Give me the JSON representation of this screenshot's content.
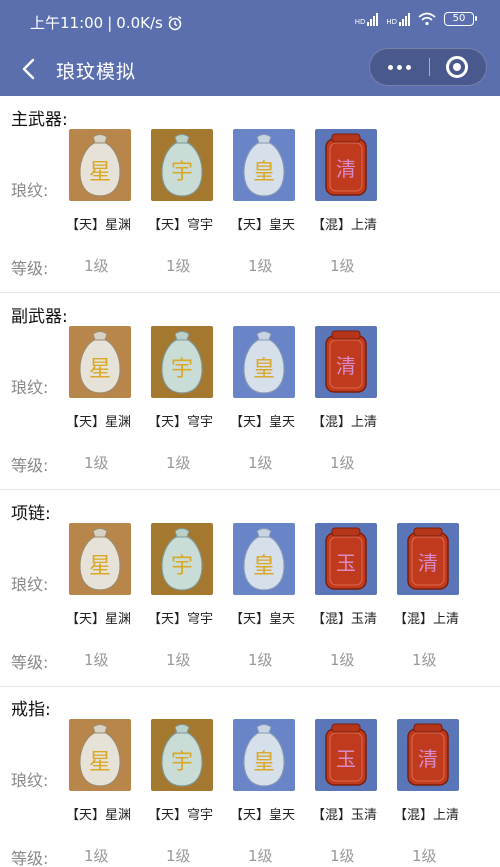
{
  "status": {
    "time": "上午11:00",
    "speed": "0.0K/s",
    "battery": "50",
    "hd1": "HD",
    "hd2": "HD"
  },
  "nav": {
    "title": "琅玟模拟"
  },
  "labels": {
    "pattern": "琅纹:",
    "level": "等级:"
  },
  "colors": {
    "header": "#5b6faf",
    "bronze_bg": "#b8864a",
    "teal_bg": "#a5782f",
    "blue_bg": "#6a85c7",
    "chaos_bg": "#5a76b8",
    "chaos_gem": "#c03a1e"
  },
  "sections": [
    {
      "title": "主武器:",
      "items": [
        {
          "name": "【天】星渊",
          "level": "1级",
          "type": "star",
          "glyph": "星"
        },
        {
          "name": "【天】穹宇",
          "level": "1级",
          "type": "sky",
          "glyph": "宇"
        },
        {
          "name": "【天】皇天",
          "level": "1级",
          "type": "emperor",
          "glyph": "皇"
        },
        {
          "name": "【混】上清",
          "level": "1级",
          "type": "chaos",
          "glyph": "清"
        }
      ]
    },
    {
      "title": "副武器:",
      "items": [
        {
          "name": "【天】星渊",
          "level": "1级",
          "type": "star",
          "glyph": "星"
        },
        {
          "name": "【天】穹宇",
          "level": "1级",
          "type": "sky",
          "glyph": "宇"
        },
        {
          "name": "【天】皇天",
          "level": "1级",
          "type": "emperor",
          "glyph": "皇"
        },
        {
          "name": "【混】上清",
          "level": "1级",
          "type": "chaos",
          "glyph": "清"
        }
      ]
    },
    {
      "title": "项链:",
      "items": [
        {
          "name": "【天】星渊",
          "level": "1级",
          "type": "star",
          "glyph": "星"
        },
        {
          "name": "【天】穹宇",
          "level": "1级",
          "type": "sky",
          "glyph": "宇"
        },
        {
          "name": "【天】皇天",
          "level": "1级",
          "type": "emperor",
          "glyph": "皇"
        },
        {
          "name": "【混】玉清",
          "level": "1级",
          "type": "chaos",
          "glyph": "玉"
        },
        {
          "name": "【混】上清",
          "level": "1级",
          "type": "chaos",
          "glyph": "清"
        }
      ]
    },
    {
      "title": "戒指:",
      "items": [
        {
          "name": "【天】星渊",
          "level": "1级",
          "type": "star",
          "glyph": "星"
        },
        {
          "name": "【天】穹宇",
          "level": "1级",
          "type": "sky",
          "glyph": "宇"
        },
        {
          "name": "【天】皇天",
          "level": "1级",
          "type": "emperor",
          "glyph": "皇"
        },
        {
          "name": "【混】玉清",
          "level": "1级",
          "type": "chaos",
          "glyph": "玉"
        },
        {
          "name": "【混】上清",
          "level": "1级",
          "type": "chaos",
          "glyph": "清"
        }
      ]
    }
  ]
}
